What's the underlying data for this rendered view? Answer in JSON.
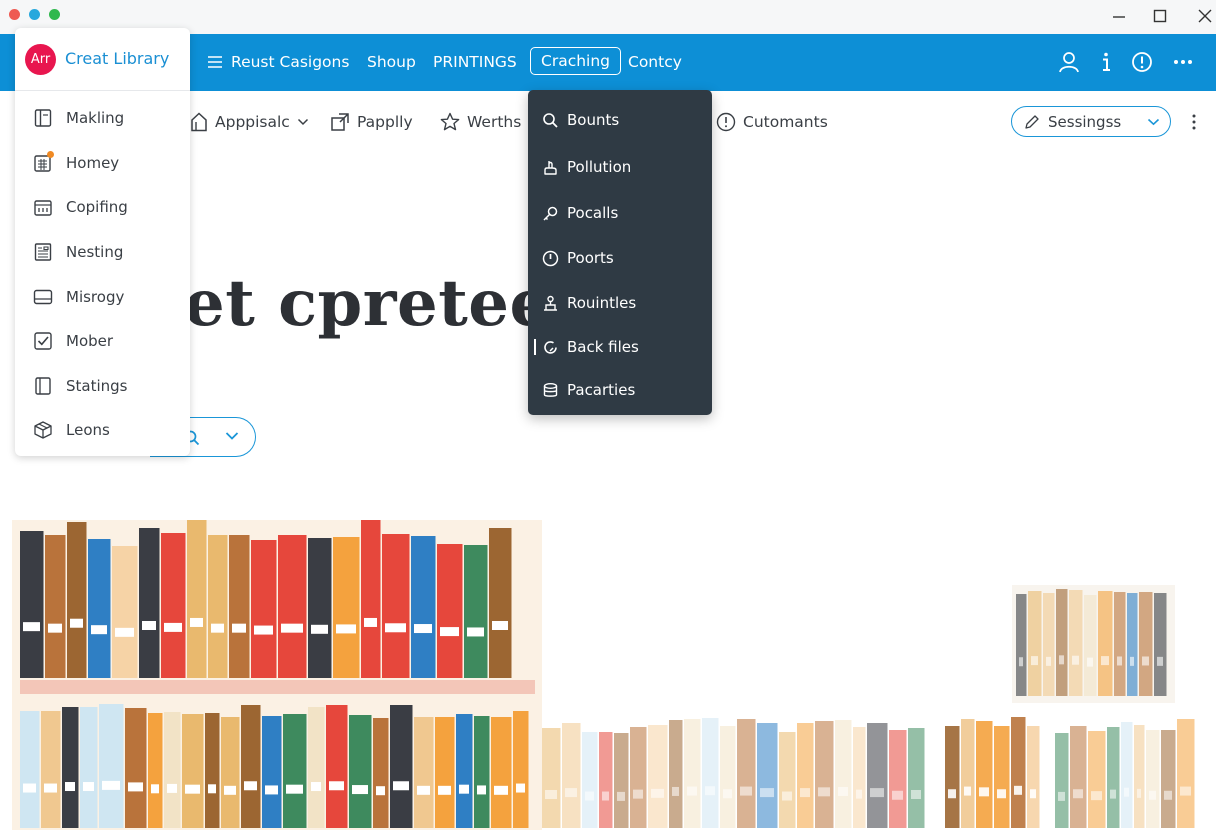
{
  "window": {
    "controls": [
      "minimize-icon",
      "maximize-icon",
      "close-icon"
    ]
  },
  "brand": {
    "logo_text": "Arr",
    "name": "Creat Library",
    "logo_color": "#e8164f"
  },
  "colors": {
    "accent": "#0d8fd6",
    "dropdown_bg": "#2f3a44"
  },
  "nav": {
    "items": [
      {
        "label": "Reust Casigons",
        "icon": "menu-icon"
      },
      {
        "label": "Shoup"
      },
      {
        "label": "PRINTINGS"
      },
      {
        "label": "Craching",
        "active": true
      },
      {
        "label": "Contcy"
      }
    ],
    "right_icons": [
      "user-icon",
      "info-icon",
      "alert-icon",
      "more-icon"
    ]
  },
  "toolbar": {
    "items": [
      {
        "label": "Apppisalc",
        "icon": "tag-icon",
        "has_dropdown": true
      },
      {
        "label": "Papplly",
        "icon": "share-icon"
      },
      {
        "label": "Werths",
        "icon": "star-icon"
      },
      {
        "label": "Cutomants",
        "icon": "alert-circle-icon"
      }
    ],
    "session_select": {
      "label": "Sessingss",
      "icon": "pen-icon"
    }
  },
  "sidebar": {
    "items": [
      {
        "label": "Makling",
        "icon": "book-icon"
      },
      {
        "label": "Homey",
        "icon": "calendar-icon",
        "badge": true
      },
      {
        "label": "Copifing",
        "icon": "calendar-grid-icon"
      },
      {
        "label": "Nesting",
        "icon": "document-icon"
      },
      {
        "label": "Misrogy",
        "icon": "display-icon"
      },
      {
        "label": "Mober",
        "icon": "checkbox-icon"
      },
      {
        "label": "Statings",
        "icon": "binder-icon"
      },
      {
        "label": "Leons",
        "icon": "box-icon"
      }
    ]
  },
  "dropdown": {
    "items": [
      {
        "label": "Bounts",
        "icon": "search-icon"
      },
      {
        "label": "Pollution",
        "icon": "hand-icon"
      },
      {
        "label": "Pocalls",
        "icon": "key-icon"
      },
      {
        "label": "Poorts",
        "icon": "clock-icon"
      },
      {
        "label": "Rouintles",
        "icon": "people-icon"
      },
      {
        "label": "Back files",
        "icon": "refresh-icon"
      },
      {
        "label": "Pacarties",
        "icon": "database-icon"
      }
    ]
  },
  "main": {
    "headline": "et cpreteeriet"
  }
}
